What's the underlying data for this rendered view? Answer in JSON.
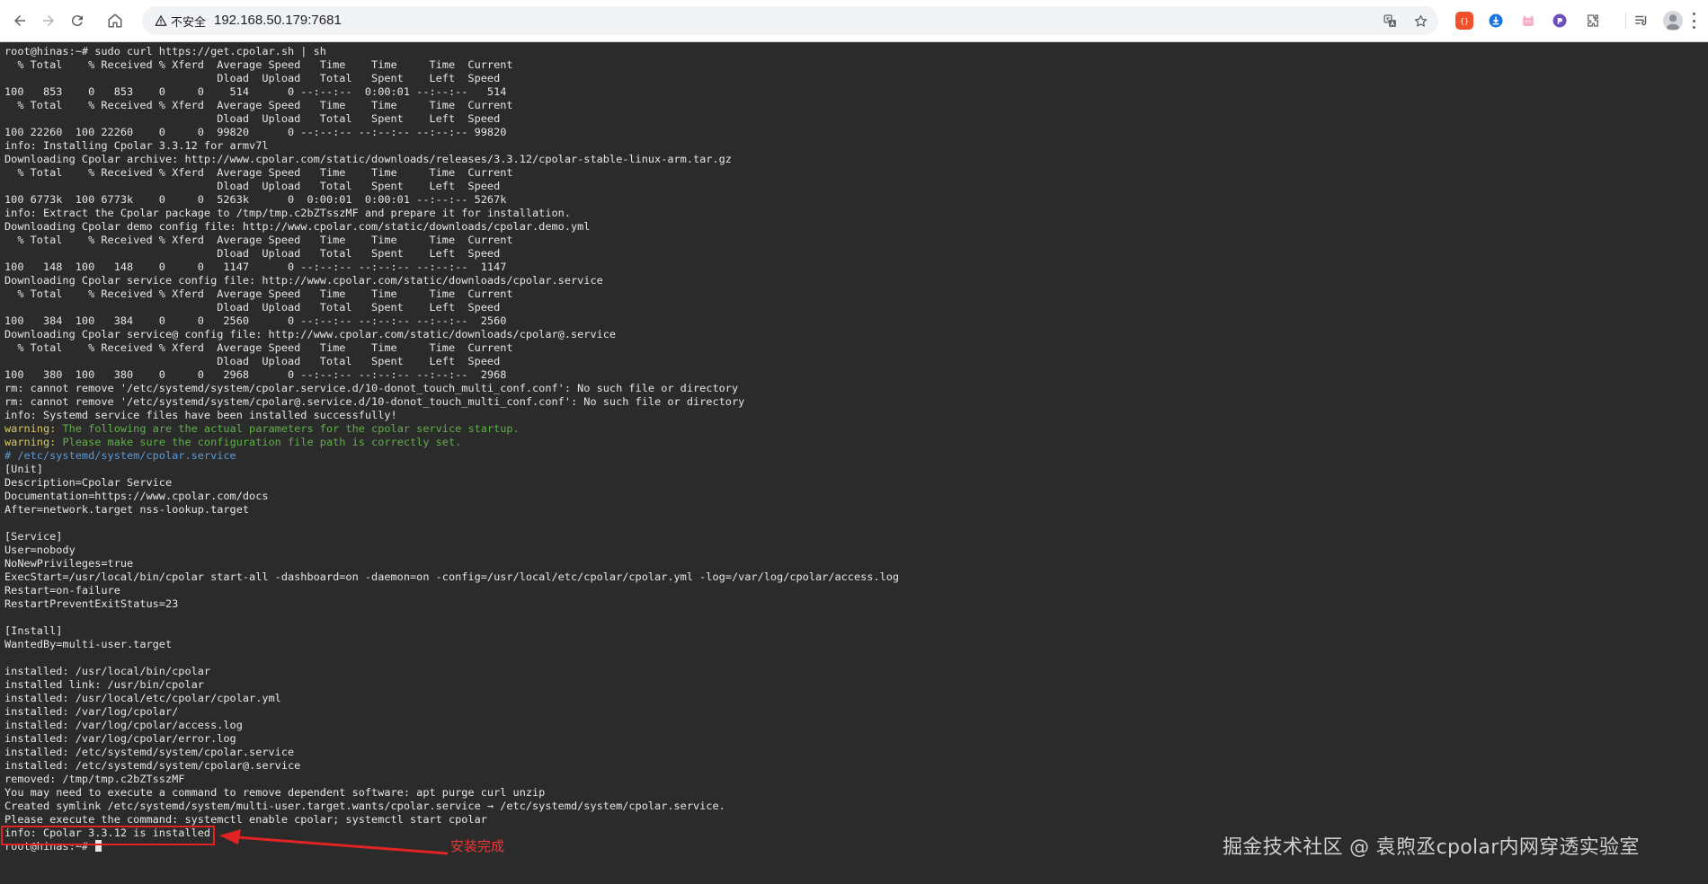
{
  "browser": {
    "security_label": "不安全",
    "url": "192.168.50.179:7681"
  },
  "terminal": {
    "lines": [
      {
        "text": "root@hinas:~# sudo curl https://get.cpolar.sh | sh"
      },
      {
        "text": "  % Total    % Received % Xferd  Average Speed   Time    Time     Time  Current"
      },
      {
        "text": "                                 Dload  Upload   Total   Spent    Left  Speed"
      },
      {
        "text": "100   853    0   853    0     0    514      0 --:--:--  0:00:01 --:--:--   514"
      },
      {
        "text": "  % Total    % Received % Xferd  Average Speed   Time    Time     Time  Current"
      },
      {
        "text": "                                 Dload  Upload   Total   Spent    Left  Speed"
      },
      {
        "text": "100 22260  100 22260    0     0  99820      0 --:--:-- --:--:-- --:--:-- 99820"
      },
      {
        "text": "info: Installing Cpolar 3.3.12 for armv7l"
      },
      {
        "text": "Downloading Cpolar archive: http://www.cpolar.com/static/downloads/releases/3.3.12/cpolar-stable-linux-arm.tar.gz"
      },
      {
        "text": "  % Total    % Received % Xferd  Average Speed   Time    Time     Time  Current"
      },
      {
        "text": "                                 Dload  Upload   Total   Spent    Left  Speed"
      },
      {
        "text": "100 6773k  100 6773k    0     0  5263k      0  0:00:01  0:00:01 --:--:-- 5267k"
      },
      {
        "text": "info: Extract the Cpolar package to /tmp/tmp.c2bZTsszMF and prepare it for installation."
      },
      {
        "text": "Downloading Cpolar demo config file: http://www.cpolar.com/static/downloads/cpolar.demo.yml"
      },
      {
        "text": "  % Total    % Received % Xferd  Average Speed   Time    Time     Time  Current"
      },
      {
        "text": "                                 Dload  Upload   Total   Spent    Left  Speed"
      },
      {
        "text": "100   148  100   148    0     0   1147      0 --:--:-- --:--:-- --:--:--  1147"
      },
      {
        "text": "Downloading Cpolar service config file: http://www.cpolar.com/static/downloads/cpolar.service"
      },
      {
        "text": "  % Total    % Received % Xferd  Average Speed   Time    Time     Time  Current"
      },
      {
        "text": "                                 Dload  Upload   Total   Spent    Left  Speed"
      },
      {
        "text": "100   384  100   384    0     0   2560      0 --:--:-- --:--:-- --:--:--  2560"
      },
      {
        "text": "Downloading Cpolar service@ config file: http://www.cpolar.com/static/downloads/cpolar@.service"
      },
      {
        "text": "  % Total    % Received % Xferd  Average Speed   Time    Time     Time  Current"
      },
      {
        "text": "                                 Dload  Upload   Total   Spent    Left  Speed"
      },
      {
        "text": "100   380  100   380    0     0   2968      0 --:--:-- --:--:-- --:--:--  2968"
      },
      {
        "text": "rm: cannot remove '/etc/systemd/system/cpolar.service.d/10-donot_touch_multi_conf.conf': No such file or directory"
      },
      {
        "text": "rm: cannot remove '/etc/systemd/system/cpolar@.service.d/10-donot_touch_multi_conf.conf': No such file or directory"
      },
      {
        "text": "info: Systemd service files have been installed successfully!"
      },
      {
        "prefix": "warning:",
        "text": " The following are the actual parameters for the cpolar service startup.",
        "color": "warning"
      },
      {
        "prefix": "warning:",
        "text": " Please make sure the configuration file path is correctly set.",
        "color": "warning"
      },
      {
        "text": "# /etc/systemd/system/cpolar.service",
        "color": "comment"
      },
      {
        "text": "[Unit]"
      },
      {
        "text": "Description=Cpolar Service"
      },
      {
        "text": "Documentation=https://www.cpolar.com/docs"
      },
      {
        "text": "After=network.target nss-lookup.target"
      },
      {
        "text": ""
      },
      {
        "text": "[Service]"
      },
      {
        "text": "User=nobody"
      },
      {
        "text": "NoNewPrivileges=true"
      },
      {
        "text": "ExecStart=/usr/local/bin/cpolar start-all -dashboard=on -daemon=on -config=/usr/local/etc/cpolar/cpolar.yml -log=/var/log/cpolar/access.log"
      },
      {
        "text": "Restart=on-failure"
      },
      {
        "text": "RestartPreventExitStatus=23"
      },
      {
        "text": ""
      },
      {
        "text": "[Install]"
      },
      {
        "text": "WantedBy=multi-user.target"
      },
      {
        "text": ""
      },
      {
        "text": "installed: /usr/local/bin/cpolar"
      },
      {
        "text": "installed link: /usr/bin/cpolar"
      },
      {
        "text": "installed: /usr/local/etc/cpolar/cpolar.yml"
      },
      {
        "text": "installed: /var/log/cpolar/"
      },
      {
        "text": "installed: /var/log/cpolar/access.log"
      },
      {
        "text": "installed: /var/log/cpolar/error.log"
      },
      {
        "text": "installed: /etc/systemd/system/cpolar.service"
      },
      {
        "text": "installed: /etc/systemd/system/cpolar@.service"
      },
      {
        "text": "removed: /tmp/tmp.c2bZTsszMF"
      },
      {
        "text": "You may need to execute a command to remove dependent software: apt purge curl unzip"
      },
      {
        "text": "Created symlink /etc/systemd/system/multi-user.target.wants/cpolar.service → /etc/systemd/system/cpolar.service."
      },
      {
        "text": "Please execute the command: systemctl enable cpolar; systemctl start cpolar"
      },
      {
        "text": "info: Cpolar 3.3.12 is installed."
      }
    ],
    "prompt": "root@hinas:~# "
  },
  "annotation": {
    "label": "安装完成"
  },
  "watermark": "掘金技术社区 @ 袁煦丞cpolar内网穿透实验室",
  "colors": {
    "terminal_bg": "#2b2b2b",
    "terminal_fg": "#e6e6e6",
    "warning": "#d7c95f",
    "warning_text": "#5fb048",
    "comment": "#5c9ad6",
    "annotation": "#e02424"
  }
}
